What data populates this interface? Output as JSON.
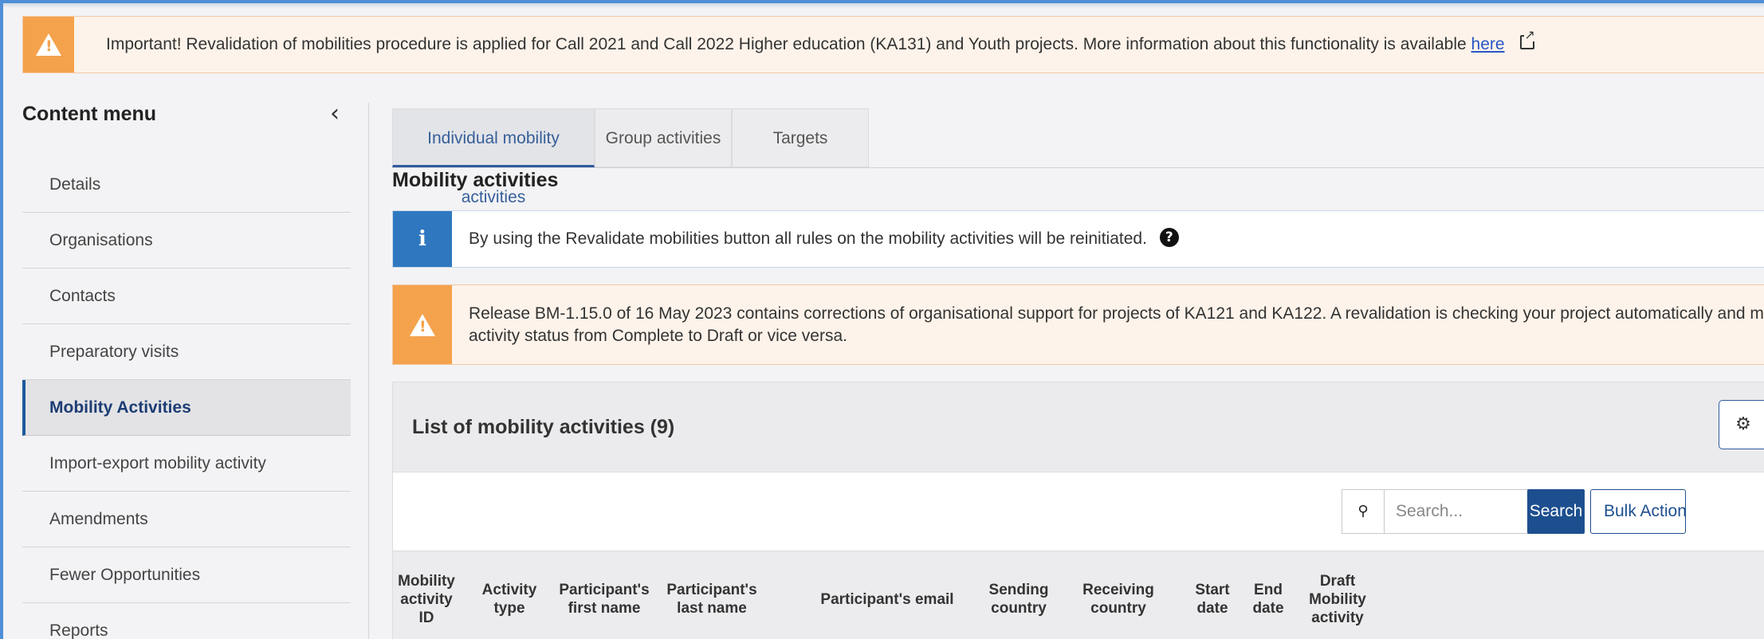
{
  "banner": {
    "text": "Important! Revalidation of mobilities procedure is applied for Call 2021 and Call 2022 Higher education (KA131) and Youth projects. More information about this functionality is available",
    "link": "here"
  },
  "sidebar": {
    "title": "Content menu",
    "collapse_icon": "‹",
    "items": [
      {
        "label": "Details"
      },
      {
        "label": "Organisations"
      },
      {
        "label": "Contacts"
      },
      {
        "label": "Preparatory visits"
      },
      {
        "label": "Mobility Activities",
        "active": true
      },
      {
        "label": "Import-export mobility activity"
      },
      {
        "label": "Amendments"
      },
      {
        "label": "Fewer Opportunities"
      },
      {
        "label": "Reports"
      }
    ]
  },
  "tabs": [
    {
      "label": "Individual mobility activities",
      "active": true
    },
    {
      "label": "Group activities"
    },
    {
      "label": "Targets"
    }
  ],
  "section_title": "Mobility activities",
  "info_message": "By using the Revalidate mobilities button all rules on the mobility activities will be reinitiated.",
  "release_message": "Release BM-1.15.0 of 16 May 2023 contains corrections of organisational support for projects of KA121 and KA122. A revalidation is checking your project automatically and mobility activity status from Complete to Draft or vice versa.",
  "list": {
    "title": "List of mobility activities (9)",
    "search_placeholder": "Search...",
    "search_button": "Search",
    "bulk_button": "Bulk Actions",
    "columns": [
      "Mobility activity ID",
      "Activity type",
      "Participant's first name",
      "Participant's last name",
      "Participant's email",
      "Sending country",
      "Receiving country",
      "Start date",
      "End date",
      "Draft Mobility activity"
    ]
  },
  "colors": {
    "accent": "#1d4f8f",
    "warning": "#f5a24c",
    "info": "#2f78c0"
  }
}
